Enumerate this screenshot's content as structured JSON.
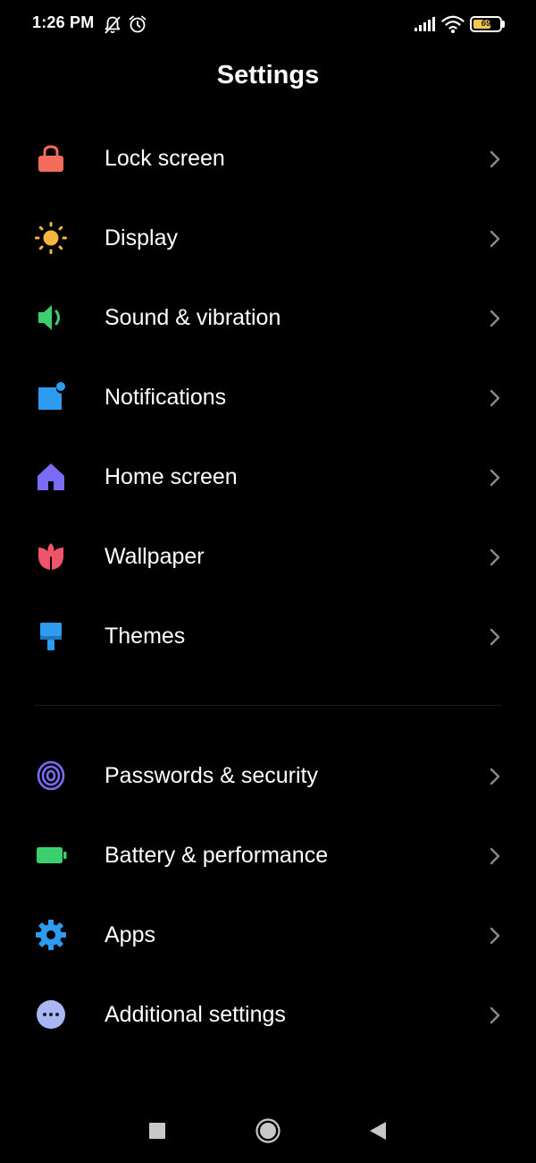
{
  "status_bar": {
    "time": "1:26 PM",
    "battery_level": "69",
    "battery_fraction": 0.69,
    "icons": [
      "notifications-off-icon",
      "alarm-icon",
      "cellular-signal-icon",
      "wifi-icon",
      "battery-icon"
    ]
  },
  "header": {
    "title": "Settings"
  },
  "settings": {
    "group1": [
      {
        "label": "Lock screen",
        "icon": "lock-icon",
        "color": "#f26b5b"
      },
      {
        "label": "Display",
        "icon": "sun-icon",
        "color": "#f5b83d"
      },
      {
        "label": "Sound & vibration",
        "icon": "speaker-icon",
        "color": "#3ccf6e"
      },
      {
        "label": "Notifications",
        "icon": "notification-icon",
        "color": "#2d9cf0"
      },
      {
        "label": "Home screen",
        "icon": "home-icon",
        "color": "#7b6cf6"
      },
      {
        "label": "Wallpaper",
        "icon": "tulip-icon",
        "color": "#f0546b"
      },
      {
        "label": "Themes",
        "icon": "paint-brush-icon",
        "color": "#2d9cf0"
      }
    ],
    "group2": [
      {
        "label": "Passwords & security",
        "icon": "fingerprint-icon",
        "color": "#7b6cf6"
      },
      {
        "label": "Battery & performance",
        "icon": "battery-icon",
        "color": "#3ccf6e"
      },
      {
        "label": "Apps",
        "icon": "gear-icon",
        "color": "#2d9cf0"
      },
      {
        "label": "Additional settings",
        "icon": "more-dots-icon",
        "color": "#a9b8f5"
      }
    ]
  },
  "nav_bar": {
    "buttons": [
      "recents-button",
      "home-button",
      "back-button"
    ]
  }
}
